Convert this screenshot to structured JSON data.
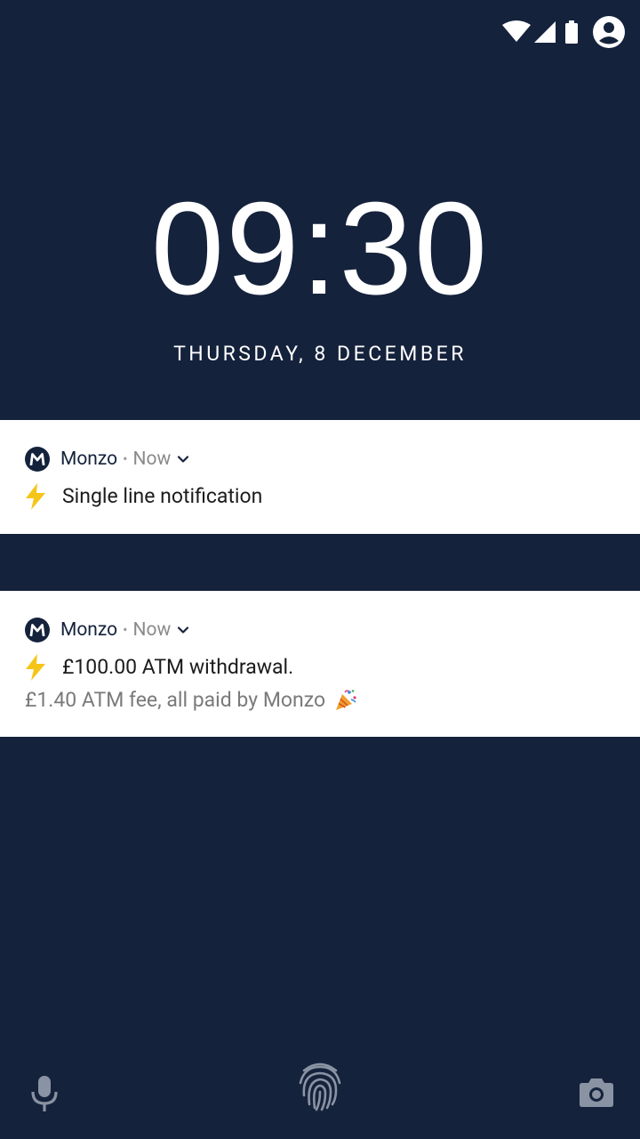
{
  "status_bar": {
    "icons": [
      "wifi-icon",
      "signal-icon",
      "battery-icon",
      "account-icon"
    ],
    "color": "#ffffff"
  },
  "lockscreen": {
    "time": "09:30",
    "date": "THURSDAY, 8 DECEMBER"
  },
  "notifications": [
    {
      "app_name": "Monzo",
      "separator": "•",
      "time": "Now",
      "icon": "lightning-bolt-icon",
      "title": "Single line notification"
    },
    {
      "app_name": "Monzo",
      "separator": "•",
      "time": "Now",
      "icon": "lightning-bolt-icon",
      "title": "£100.00 ATM withdrawal.",
      "body": "£1.40 ATM fee, all paid by Monzo",
      "body_icon": "party-popper-icon"
    }
  ],
  "bottom_shortcuts": [
    "microphone-icon",
    "fingerprint-icon",
    "camera-icon"
  ],
  "colors": {
    "background": "#15223c",
    "card": "#ffffff",
    "brand": "#15223c",
    "bolt": "#f5c518",
    "muted_text": "#7a7a7a"
  }
}
